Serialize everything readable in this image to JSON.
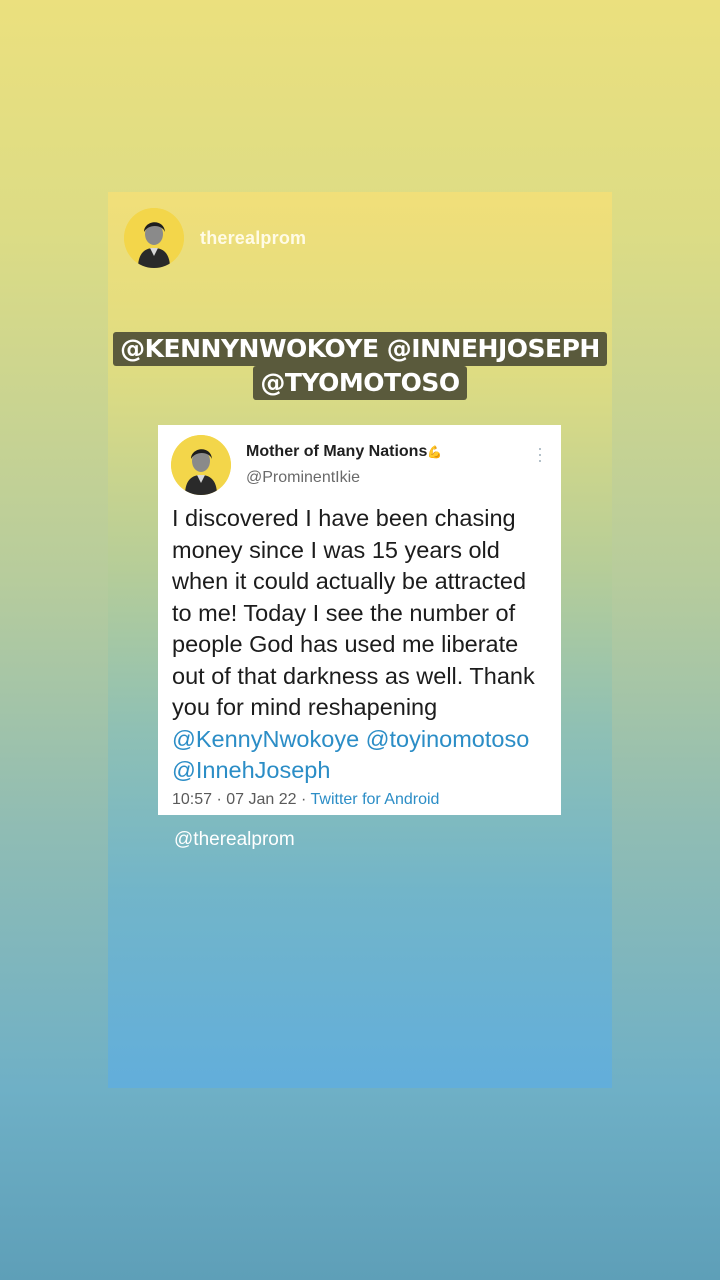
{
  "story": {
    "username": "therealprom",
    "tags_line1": "@KENNYNWOKOYE @INNEHJOSEPH",
    "tags_line2": "@TYOMOTOSO",
    "footer_mention": "@therealprom"
  },
  "tweet": {
    "display_name": "Mother of Many Nations",
    "name_emoji": "💪",
    "handle": "@ProminentIkie",
    "text": "I discovered I have been chasing money since I was 15 years old when it could actually be attracted to me! Today I see the number of people God has used me liberate out of that darkness as well. Thank you for mind reshapening",
    "mentions": [
      "@KennyNwokoye",
      "@toyinomotoso",
      "@InnehJoseph"
    ],
    "time": "10:57",
    "date": "07 Jan 22",
    "separator": "·",
    "source": "Twitter for Android"
  },
  "colors": {
    "mention_blue": "#2b8dc6",
    "tag_bg": "#5a5a3c",
    "avatar_yellow": "#f3d64a"
  },
  "icons": [
    "avatar-image",
    "more-options-icon",
    "flexed-biceps-emoji"
  ]
}
